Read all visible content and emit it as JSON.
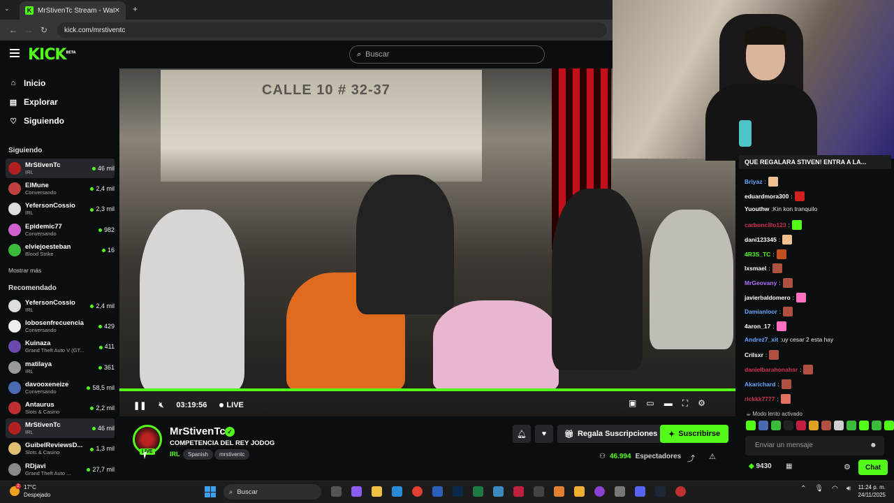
{
  "browser": {
    "tab_title": "MrStivenTc Stream - Watch",
    "url": "kick.com/mrstiventc"
  },
  "header": {
    "logo": "KICK",
    "logo_beta": "BETA",
    "search_placeholder": "Buscar"
  },
  "sidebar": {
    "nav": [
      {
        "label": "Inicio",
        "icon": "home-icon"
      },
      {
        "label": "Explorar",
        "icon": "browse-icon"
      },
      {
        "label": "Siguiendo",
        "icon": "heart-icon"
      }
    ],
    "following_title": "Siguiendo",
    "following": [
      {
        "name": "MrStivenTc",
        "category": "IRL",
        "viewers": "46 mil",
        "color": "#b02020"
      },
      {
        "name": "ElMune",
        "category": "Conversando",
        "viewers": "2,4 mil",
        "color": "#c04040"
      },
      {
        "name": "YefersonCossio",
        "category": "IRL",
        "viewers": "2,3 mil",
        "color": "#ddd"
      },
      {
        "name": "Epidemic77",
        "category": "Conversando",
        "viewers": "982",
        "color": "#d060d0"
      },
      {
        "name": "elviejoesteban",
        "category": "Blood Strike",
        "viewers": "16",
        "color": "#3cba3c"
      }
    ],
    "show_more": "Mostrar más",
    "recommended_title": "Recomendado",
    "recommended": [
      {
        "name": "YefersonCossio",
        "category": "IRL",
        "viewers": "2,4 mil",
        "color": "#ddd"
      },
      {
        "name": "lobosenfrecuencia",
        "category": "Conversando",
        "viewers": "429",
        "color": "#eee"
      },
      {
        "name": "Kuinaza",
        "category": "Grand Theft Auto V (GT...",
        "viewers": "411",
        "color": "#6a4ab0"
      },
      {
        "name": "matilaya",
        "category": "IRL",
        "viewers": "361",
        "color": "#999"
      },
      {
        "name": "davooxeneize",
        "category": "Conversando",
        "viewers": "58,5 mil",
        "color": "#4a6ab0"
      },
      {
        "name": "Antaurus",
        "category": "Slots & Casino",
        "viewers": "2,2 mil",
        "color": "#c03030"
      },
      {
        "name": "MrStivenTc",
        "category": "IRL",
        "viewers": "46 mil",
        "color": "#b02020"
      },
      {
        "name": "GuibelReviewsD...",
        "category": "Slots & Casino",
        "viewers": "1,3 mil",
        "color": "#e0c070"
      },
      {
        "name": "RDjavi",
        "category": "Grand Theft Auto ...",
        "viewers": "27,7 mil",
        "color": "#888"
      }
    ]
  },
  "video": {
    "sign": "CALLE 10 # 32-37",
    "time": "03:19:56",
    "live": "LIVE",
    "progress": 1.0
  },
  "stream": {
    "name": "MrStivenTc",
    "title": "COMPETENCIA DEL REY JODOG",
    "category": "IRL",
    "tags": [
      "Spanish",
      "mrstiventc"
    ],
    "live_badge": "LIVE",
    "gift_label": "Regala Suscripciones",
    "subscribe_label": "Suscribirse",
    "viewers": "46.994",
    "viewers_label": "Espectadores"
  },
  "chat": {
    "pinned": "QUE REGALARA STIVEN! ENTRA A LA...",
    "messages": [
      {
        "user": "Briyaz",
        "color": "#6aa6ff",
        "text": "",
        "emote": "#f0c090"
      },
      {
        "user": "eduardmora300",
        "color": "#ffffff",
        "text": "",
        "emote": "#d02020"
      },
      {
        "user": "Yuouthw",
        "color": "#ffffff",
        "text": "Kin kon tranquilo",
        "emote": ""
      },
      {
        "user": "carboncillo123",
        "color": "#d03050",
        "text": "",
        "emote": "#53fc18"
      },
      {
        "user": "dani123345",
        "color": "#ffffff",
        "text": "",
        "emote": "#f0c090"
      },
      {
        "user": "4R3S_TC",
        "color": "#53fc18",
        "text": "",
        "emote": "#c05020"
      },
      {
        "user": "lxsmael",
        "color": "#ffffff",
        "text": "",
        "emote": "#b05040"
      },
      {
        "user": "MrGeovany",
        "color": "#b070ff",
        "text": "",
        "emote": "#b05040"
      },
      {
        "user": "javierbaldomero",
        "color": "#ffffff",
        "text": "",
        "emote": "#ff70c0"
      },
      {
        "user": "Damianloor",
        "color": "#6aa6ff",
        "text": "",
        "emote": "#b05040"
      },
      {
        "user": "4aron_17",
        "color": "#ffffff",
        "text": "",
        "emote": "#ff70c0"
      },
      {
        "user": "Andrez7_xit",
        "color": "#6aa6ff",
        "text": "uy cesar 2 esta hay",
        "emote": ""
      },
      {
        "user": "Crilsxr",
        "color": "#ffffff",
        "text": "",
        "emote": "#b05040"
      },
      {
        "user": "danielbarahonahsr",
        "color": "#d03050",
        "text": "",
        "emote": "#b05040"
      },
      {
        "user": "Akarichard",
        "color": "#6aa6ff",
        "text": "",
        "emote": "#b05040"
      },
      {
        "user": "rickkk7777",
        "color": "#d03050",
        "text": "",
        "emote": "#e07060"
      }
    ],
    "slow_mode": "Modo lento activado",
    "input_placeholder": "Enviar un mensaje",
    "points": "9430",
    "chat_button": "Chat"
  },
  "taskbar": {
    "temp": "17°C",
    "weather": "Despejado",
    "search": "Buscar",
    "time": "11:24 p. m.",
    "date": "24/11/2025",
    "notif": "2"
  }
}
